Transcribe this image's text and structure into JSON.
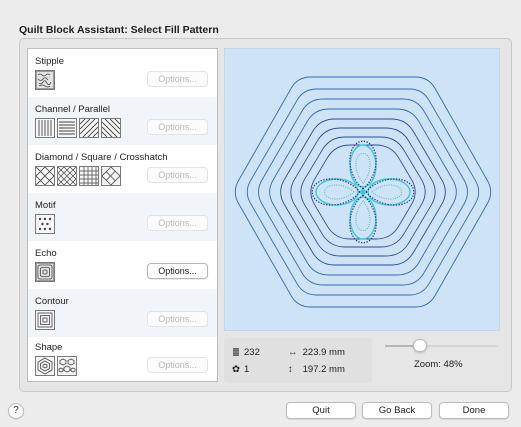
{
  "window": {
    "title": "Quilt Block Assistant: Select Fill Pattern"
  },
  "patterns": [
    {
      "label": "Stipple",
      "swatches": [
        "stipple-swatch"
      ],
      "options_label": "Options...",
      "options_enabled": false
    },
    {
      "label": "Channel / Parallel",
      "swatches": [
        "vertical-lines-swatch",
        "horizontal-lines-swatch",
        "diagonal-right-swatch",
        "diagonal-left-swatch"
      ],
      "options_label": "Options...",
      "options_enabled": false
    },
    {
      "label": "Diamond / Square / Crosshatch",
      "swatches": [
        "diamond-swatch",
        "diamond-dense-swatch",
        "square-grid-swatch",
        "crosshatch-swatch"
      ],
      "options_label": "Options...",
      "options_enabled": false
    },
    {
      "label": "Motif",
      "swatches": [
        "motif-dots-swatch"
      ],
      "options_label": "Options...",
      "options_enabled": false
    },
    {
      "label": "Echo",
      "swatches": [
        "echo-swatch"
      ],
      "options_label": "Options...",
      "options_enabled": true
    },
    {
      "label": "Contour",
      "swatches": [
        "contour-swatch"
      ],
      "options_label": "Options...",
      "options_enabled": false
    },
    {
      "label": "Shape",
      "swatches": [
        "shape-hexagon-swatch",
        "shape-cluster-swatch"
      ],
      "options_label": "Options...",
      "options_enabled": false
    }
  ],
  "stats": {
    "stitches": "232",
    "colors": "1",
    "width": "223.9 mm",
    "height": "197.2 mm"
  },
  "zoom": {
    "label": "Zoom: 48%",
    "value_percent": 48
  },
  "buttons": {
    "help": "?",
    "quit": "Quit",
    "go_back": "Go Back",
    "done": "Done"
  },
  "colors": {
    "preview_bg": "#cfe3f7",
    "outline_blue": "#2f6bb5",
    "flower_teal": "#3cc7d8",
    "flower_navy": "#233a8a",
    "flower_dots": "#6b6ba8"
  }
}
